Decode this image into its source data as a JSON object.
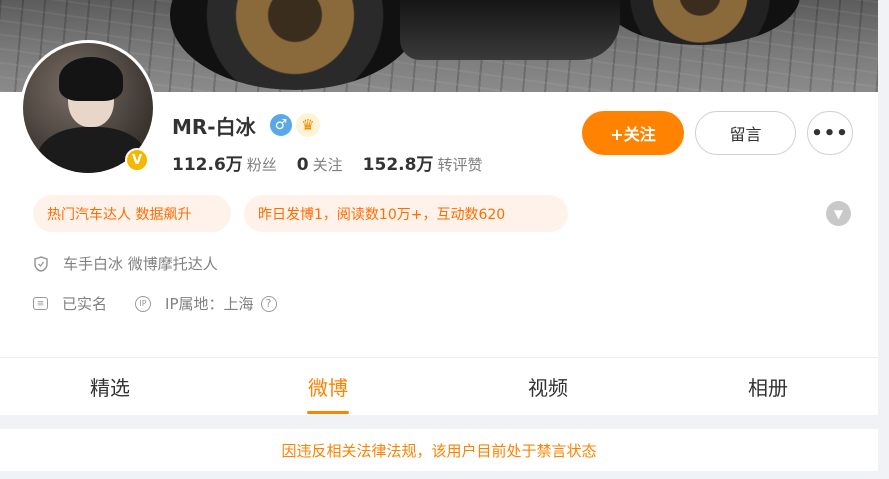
{
  "profile": {
    "name": "MR-白冰",
    "verified_badge": "V",
    "gender_symbol": "♂",
    "gender_icon": "male-icon",
    "crown_icon": "crown-icon",
    "stats": {
      "fans_value": "112.6万",
      "fans_label": "粉丝",
      "following_value": "0",
      "following_label": "关注",
      "reposts_value": "152.8万",
      "reposts_label": "转评赞"
    }
  },
  "actions": {
    "follow_label": "+关注",
    "message_label": "留言",
    "more_label": "•••"
  },
  "tags": {
    "tag1": "热门汽车达人 数据飙升",
    "tag2": "昨日发博1，阅读数10万+，互动数620"
  },
  "info": {
    "description": "车手白冰 微博摩托达人",
    "verified_text": "已实名",
    "ip_label": "IP属地：上海"
  },
  "tabs": {
    "featured": "精选",
    "weibo": "微博",
    "video": "视频",
    "album": "相册",
    "active": "微博"
  },
  "notice": "因违反相关法律法规，该用户目前处于禁言状态",
  "colors": {
    "accent": "#ff8200",
    "tag_bg": "#fff2ea",
    "tag_text": "#ff6c00",
    "verified": "#f5b800"
  }
}
